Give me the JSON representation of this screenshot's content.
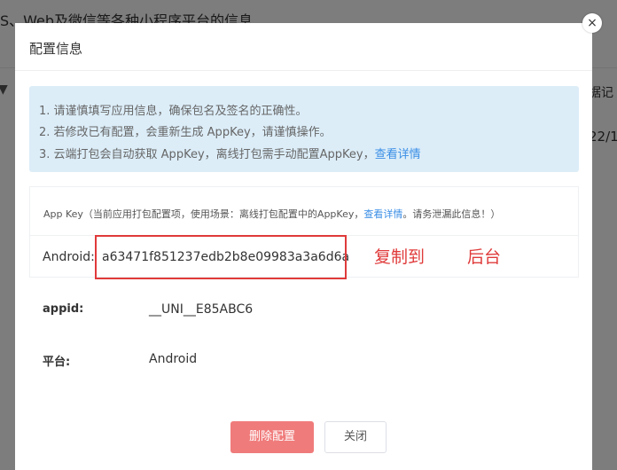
{
  "background": {
    "title": "S、Web及微信等各种小程序平台的信息",
    "right_header": "据记",
    "right_cell": "22/1",
    "filter_icon": "filter-icon"
  },
  "dialog": {
    "title": "配置信息",
    "close_glyph": "×",
    "notice": {
      "line1": "1. 请谨慎填写应用信息，确保包名及签名的正确性。",
      "line2": "2. 若修改已有配置，会重新生成 AppKey，请谨慎操作。",
      "line3_text": "3. 云端打包会自动获取 AppKey，离线打包需手动配置AppKey，",
      "line3_link": "查看详情"
    },
    "appkey": {
      "head_text": "App Key（当前应用打包配置项，使用场景：离线打包配置中的AppKey，",
      "head_link": "查看详情",
      "head_suffix": "。请务泄漏此信息！）",
      "android_label": "Android:",
      "android_value": "a63471f851237edb2b8e09983a3a6d6a"
    },
    "annotation": {
      "text1": "复制到",
      "text2": "后台",
      "color": "#e03a3a"
    },
    "fields": {
      "appid_label": "appid:",
      "appid_value": "__UNI__E85ABC6",
      "platform_label": "平台:",
      "platform_value": "Android"
    },
    "buttons": {
      "delete_label": "删除配置",
      "close_label": "关闭"
    }
  },
  "colors": {
    "notice_bg": "#dcedf8",
    "link": "#3a8ee6",
    "danger_button": "#f07b7b"
  }
}
